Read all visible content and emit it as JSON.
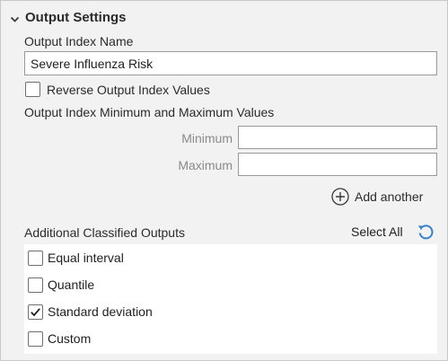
{
  "output_settings": {
    "title": "Output Settings",
    "output_index_name_label": "Output Index Name",
    "output_index_name_value": "Severe Influenza Risk",
    "reverse_label": "Reverse Output Index Values",
    "reverse_checked": false,
    "min_max_label": "Output Index Minimum and Maximum Values",
    "minimum_label": "Minimum",
    "minimum_value": "",
    "maximum_label": "Maximum",
    "maximum_value": "",
    "add_another_label": "Add another",
    "additional_outputs_label": "Additional Classified Outputs",
    "select_all_label": "Select All",
    "classified_outputs": [
      {
        "label": "Equal interval",
        "checked": false
      },
      {
        "label": "Quantile",
        "checked": false
      },
      {
        "label": "Standard deviation",
        "checked": true
      },
      {
        "label": "Custom",
        "checked": false
      }
    ]
  },
  "colors": {
    "accent_blue": "#3a7fc8",
    "panel_bg": "#f2f2f2",
    "border": "#9a9a9a"
  },
  "icons": {
    "collapse": "chevron-down-icon",
    "add": "plus-circle-icon",
    "select_all": "refresh-icon",
    "check": "checkmark-icon"
  }
}
